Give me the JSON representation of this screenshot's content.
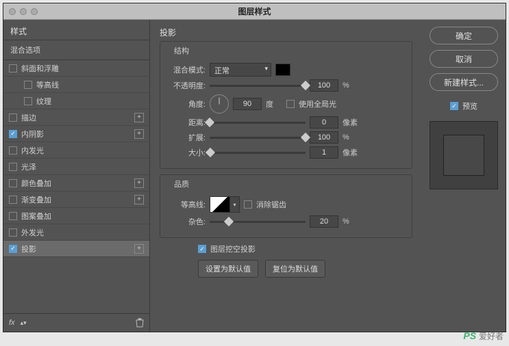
{
  "dialog": {
    "title": "图层样式"
  },
  "sidebar": {
    "header": "样式",
    "subheader": "混合选项",
    "items": [
      {
        "label": "斜面和浮雕",
        "checked": false,
        "plus": false,
        "indent": false
      },
      {
        "label": "等高线",
        "checked": false,
        "plus": false,
        "indent": true
      },
      {
        "label": "纹理",
        "checked": false,
        "plus": false,
        "indent": true
      },
      {
        "label": "描边",
        "checked": false,
        "plus": true,
        "indent": false
      },
      {
        "label": "内阴影",
        "checked": true,
        "plus": true,
        "indent": false
      },
      {
        "label": "内发光",
        "checked": false,
        "plus": false,
        "indent": false
      },
      {
        "label": "光泽",
        "checked": false,
        "plus": false,
        "indent": false
      },
      {
        "label": "颜色叠加",
        "checked": false,
        "plus": true,
        "indent": false
      },
      {
        "label": "渐变叠加",
        "checked": false,
        "plus": true,
        "indent": false
      },
      {
        "label": "图案叠加",
        "checked": false,
        "plus": false,
        "indent": false
      },
      {
        "label": "外发光",
        "checked": false,
        "plus": false,
        "indent": false
      },
      {
        "label": "投影",
        "checked": true,
        "plus": true,
        "indent": false,
        "active": true
      }
    ],
    "footer_fx": "fx"
  },
  "main": {
    "section_title": "投影",
    "structure": {
      "legend": "结构",
      "blend_label": "混合模式:",
      "blend_value": "正常",
      "opacity_label": "不透明度:",
      "opacity_value": "100",
      "opacity_unit": "%",
      "angle_label": "角度:",
      "angle_value": "90",
      "angle_unit": "度",
      "global_light_label": "使用全局光",
      "global_light_checked": false,
      "distance_label": "距离:",
      "distance_value": "0",
      "distance_unit": "像素",
      "spread_label": "扩展:",
      "spread_value": "100",
      "spread_unit": "%",
      "size_label": "大小:",
      "size_value": "1",
      "size_unit": "像素"
    },
    "quality": {
      "legend": "品质",
      "contour_label": "等高线:",
      "antialias_label": "消除锯齿",
      "antialias_checked": false,
      "noise_label": "杂色:",
      "noise_value": "20",
      "noise_unit": "%"
    },
    "knockout_label": "图层挖空投影",
    "knockout_checked": true,
    "set_default": "设置为默认值",
    "reset_default": "复位为默认值"
  },
  "right": {
    "ok": "确定",
    "cancel": "取消",
    "new_style": "新建样式...",
    "preview_label": "预览",
    "preview_checked": true
  },
  "watermark": {
    "ps": "PS",
    "txt": "爱好者"
  }
}
